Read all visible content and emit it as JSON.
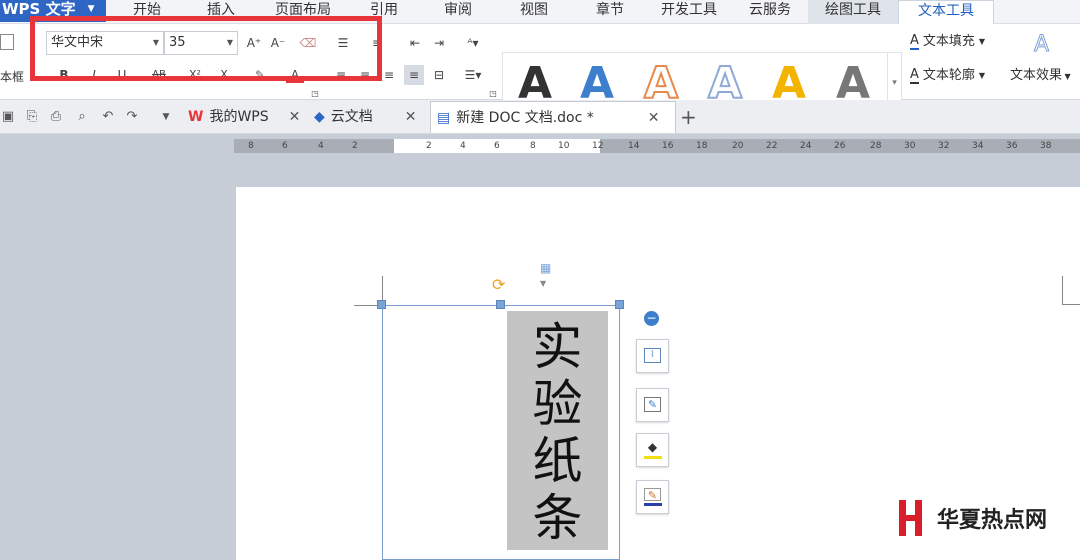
{
  "app": {
    "title": "WPS 文字"
  },
  "menu": {
    "tabs": [
      "开始",
      "插入",
      "页面布局",
      "引用",
      "审阅",
      "视图",
      "章节",
      "开发工具",
      "云服务",
      "绘图工具",
      "文本工具"
    ],
    "active": "文本工具"
  },
  "ribbon": {
    "left_cut_label": "本框",
    "font_name": "华文中宋",
    "font_size": "35",
    "grow_font": "A⁺",
    "shrink_font": "A⁻",
    "bold": "B",
    "italic": "I",
    "underline": "U",
    "strike_ab": "AB",
    "superscript": "X²",
    "subscript": "X",
    "font_color": "A",
    "text_fill_label": "文本填充",
    "text_outline_label": "文本轮廓",
    "text_effect_label": "文本效果",
    "art_letter": "A"
  },
  "colors": {
    "wps_blue": "#2e66c5",
    "highlight_red": "#e8353b",
    "art_black": "#111111",
    "art_blue": "#3d7fcc",
    "art_orange": "#e8894a",
    "art_outline": "#8fa9d6",
    "art_yellow": "#f2b400",
    "art_gray": "#555555"
  },
  "tabs": {
    "mywps": "我的WPS",
    "cloud": "云文档",
    "doc": "新建 DOC 文档.doc *",
    "new_tab": "+"
  },
  "ruler": {
    "ticks": [
      "8",
      "6",
      "4",
      "2",
      "",
      "2",
      "4",
      "6",
      "8",
      "10",
      "12",
      "14",
      "16",
      "18",
      "20",
      "22",
      "24",
      "26",
      "28",
      "30",
      "32",
      "34",
      "36",
      "38"
    ]
  },
  "document": {
    "vertical_text": [
      "实",
      "验",
      "纸",
      "条"
    ]
  },
  "watermark": {
    "text": "华夏热点网"
  }
}
